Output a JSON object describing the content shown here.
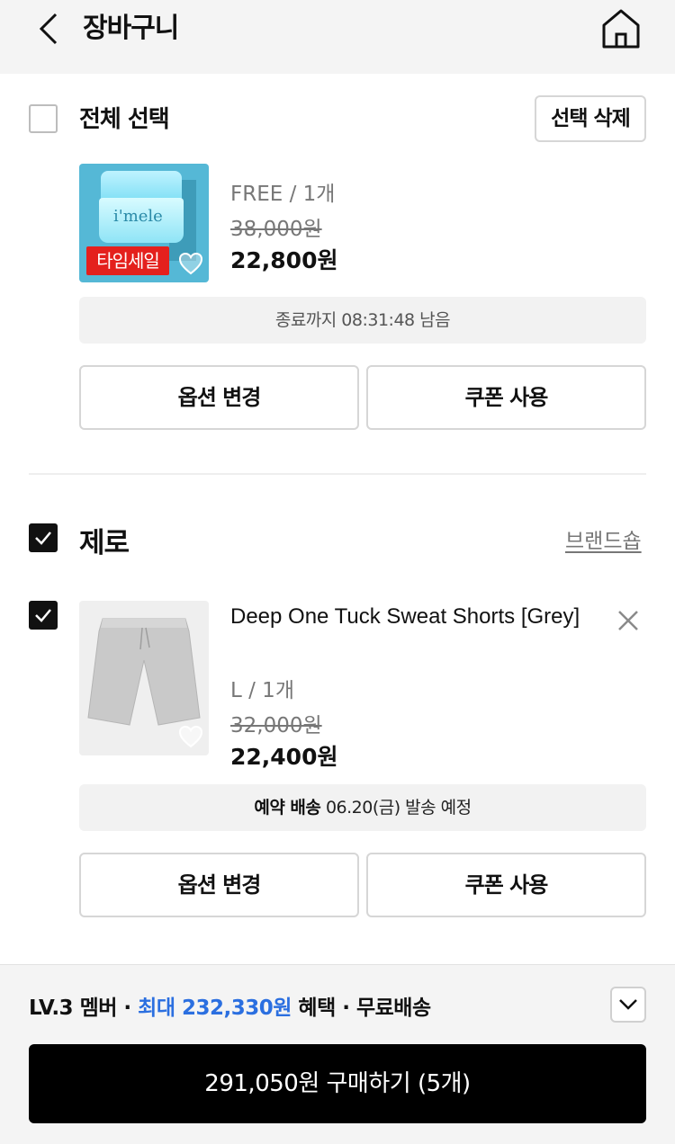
{
  "header": {
    "title": "장바구니",
    "back_icon": "chevron-left-icon",
    "home_icon": "home-icon"
  },
  "select_all": {
    "label": "전체 선택",
    "delete_selected_label": "선택 삭제",
    "checked": false
  },
  "items": [
    {
      "brand": "",
      "product_name": "",
      "image_text": "i'mele",
      "badge": "타임세일",
      "option": "FREE / 1개",
      "original_price": "38,000원",
      "sale_price": "22,800원",
      "notice": "종료까지 08:31:48  남음",
      "option_change_label": "옵션 변경",
      "coupon_label": "쿠폰 사용"
    },
    {
      "checked": true,
      "brand": "제로",
      "brand_shop_label": "브랜드숍",
      "product_name": "Deep One Tuck Sweat Shorts [Grey]",
      "option": "L / 1개",
      "original_price": "32,000원",
      "sale_price": "22,400원",
      "notice_bold": "예약 배송",
      "notice": "06.20(금) 발송 예정",
      "option_change_label": "옵션 변경",
      "coupon_label": "쿠폰 사용"
    }
  ],
  "bottom": {
    "member_level": "LV.3 멤버 · ",
    "benefit_amount": "최대 232,330원",
    "benefit_suffix": " 혜택 · 무료배송",
    "purchase_label": "291,050원 구매하기 (5개)"
  },
  "colors": {
    "accent_blue": "#2b6fe0",
    "sale_red": "#e4201d",
    "primary_button": "#000000"
  }
}
